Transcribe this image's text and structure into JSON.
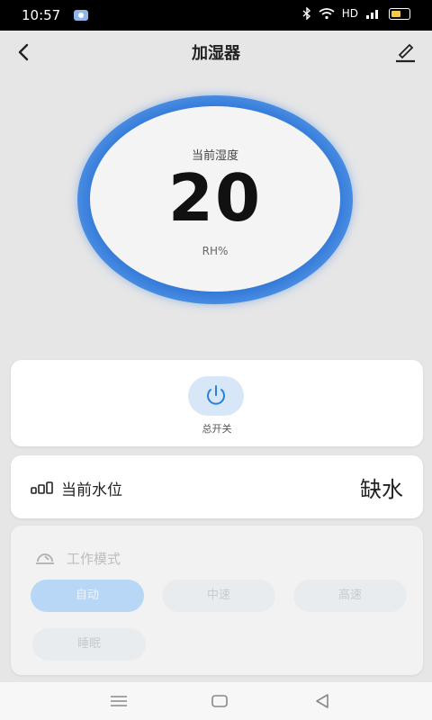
{
  "status": {
    "time": "10:57",
    "network": "HD"
  },
  "header": {
    "title": "加湿器"
  },
  "gauge": {
    "label": "当前湿度",
    "value": "20",
    "unit": "RH%"
  },
  "power": {
    "label": "总开关"
  },
  "water": {
    "label": "当前水位",
    "value": "缺水"
  },
  "mode": {
    "title": "工作模式",
    "options": [
      "自动",
      "中速",
      "高速",
      "睡眠"
    ],
    "selected": "自动"
  },
  "colors": {
    "accent": "#2d74d4",
    "power_bg": "#d7e7f8",
    "selected_mode": "#b8d6f6"
  },
  "icons": [
    "back-icon",
    "edit-icon",
    "power-icon",
    "water-level-icon",
    "mode-icon",
    "menu-icon",
    "home-icon",
    "back-triangle-icon"
  ]
}
